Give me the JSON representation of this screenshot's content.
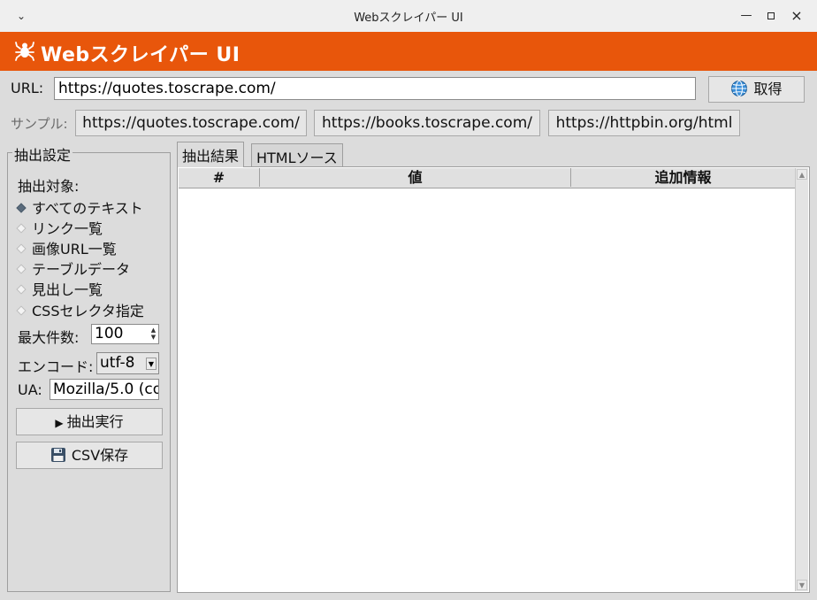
{
  "window": {
    "title": "Webスクレイパー UI"
  },
  "header": {
    "title": "Webスクレイパー UI",
    "color": "#e8560b"
  },
  "url_row": {
    "label": "URL:",
    "value": "https://quotes.toscrape.com/",
    "fetch_label": "取得",
    "fetch_icon": "globe-icon"
  },
  "samples": {
    "label": "サンプル:",
    "items": [
      "https://quotes.toscrape.com/",
      "https://books.toscrape.com/",
      "https://httpbin.org/html"
    ]
  },
  "settings": {
    "title": "抽出設定",
    "target_label": "抽出対象:",
    "options": [
      {
        "label": "すべてのテキスト",
        "selected": true
      },
      {
        "label": "リンク一覧",
        "selected": false
      },
      {
        "label": "画像URL一覧",
        "selected": false
      },
      {
        "label": "テーブルデータ",
        "selected": false
      },
      {
        "label": "見出し一覧",
        "selected": false
      },
      {
        "label": "CSSセレクタ指定",
        "selected": false
      }
    ],
    "max_label": "最大件数:",
    "max_value": "100",
    "encoding_label": "エンコード:",
    "encoding_value": "utf-8",
    "ua_label": "UA:",
    "ua_value": "Mozilla/5.0 (co",
    "run_label": "抽出実行",
    "csv_label": "CSV保存"
  },
  "tabs": [
    {
      "label": "抽出結果",
      "active": true
    },
    {
      "label": "HTMLソース",
      "active": false
    }
  ],
  "results_table": {
    "columns": [
      "#",
      "値",
      "追加情報"
    ],
    "rows": []
  }
}
